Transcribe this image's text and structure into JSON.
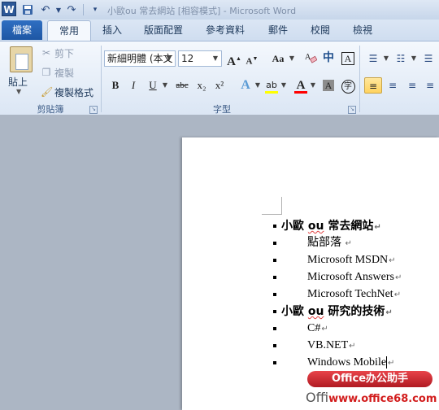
{
  "titlebar": {
    "app_icon": "W",
    "doc_title": "小歐ou 常去網站 [相容模式] - Microsoft Word"
  },
  "tabs": {
    "file": "檔案",
    "items": [
      "常用",
      "插入",
      "版面配置",
      "參考資料",
      "郵件",
      "校閱",
      "檢視"
    ],
    "active": "常用"
  },
  "clipboard": {
    "paste": "貼上",
    "cut": "剪下",
    "copy": "複製",
    "format_painter": "複製格式",
    "group_label": "剪貼簿"
  },
  "font": {
    "font_name": "新細明體 (本文",
    "font_size": "12",
    "grow": "A",
    "shrink": "A",
    "case": "Aa",
    "bold": "B",
    "italic": "I",
    "underline": "U",
    "strike": "abc",
    "subscript": "x₂",
    "superscript": "x²",
    "effects": "A",
    "highlight": "ab",
    "font_color": "A",
    "char_shade": "A",
    "enclose": "字",
    "phonetic": "中",
    "border": "A",
    "group_label": "字型"
  },
  "document": {
    "lines": [
      {
        "level": 1,
        "text": "小歐 ou 常去網站",
        "squiggle": "ou"
      },
      {
        "level": 2,
        "text": "點部落"
      },
      {
        "level": 2,
        "text": "Microsoft MSDN"
      },
      {
        "level": 2,
        "text": "Microsoft Answers"
      },
      {
        "level": 2,
        "text": "Microsoft TechNet"
      },
      {
        "level": 1,
        "text": "小歐 ou 研究的技術",
        "squiggle": "ou"
      },
      {
        "level": 2,
        "text": "C#"
      },
      {
        "level": 2,
        "text": "VB.NET"
      },
      {
        "level": 2,
        "text": "Windows Mobile"
      }
    ],
    "paragraph_mark": "↵"
  },
  "watermark": {
    "badge": "Office办公助手",
    "site_prefix": "Offi",
    "site": "www.office68.com"
  },
  "colors": {
    "file_tab": "#1e57a4",
    "highlight": "#ffff00",
    "font_color": "#ff0000",
    "active_button": "#ffd35e"
  }
}
